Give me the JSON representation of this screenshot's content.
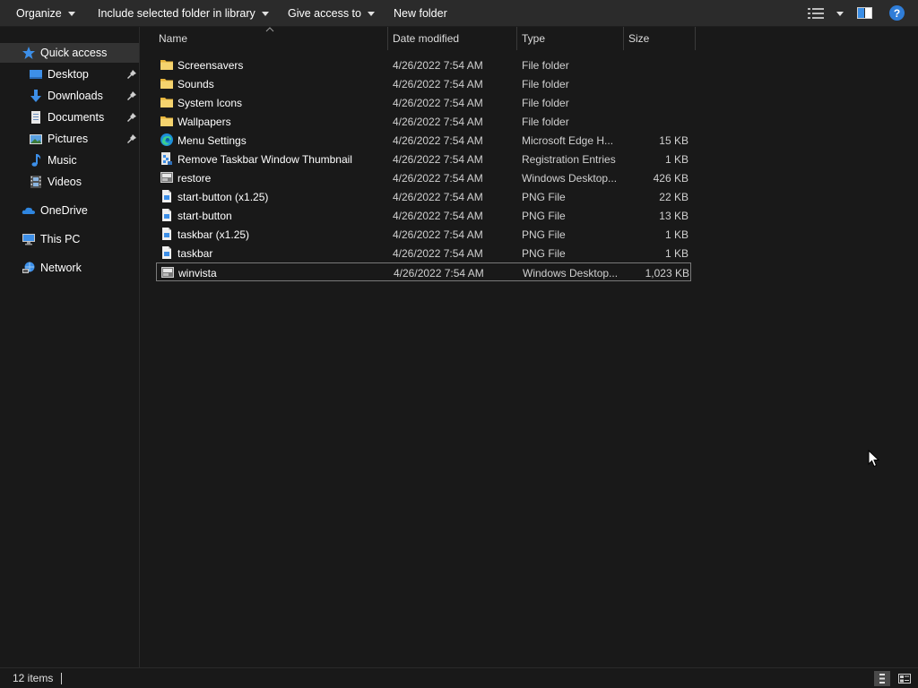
{
  "toolbar": {
    "organize": "Organize",
    "include_library": "Include selected folder in library",
    "give_access": "Give access to",
    "new_folder": "New folder",
    "help": "?"
  },
  "sidebar": {
    "items": [
      {
        "label": "Quick access",
        "icon": "star-icon",
        "pinned": false,
        "active": true
      },
      {
        "label": "Desktop",
        "icon": "desktop-icon",
        "pinned": true
      },
      {
        "label": "Downloads",
        "icon": "download-arrow-icon",
        "pinned": true
      },
      {
        "label": "Documents",
        "icon": "documents-icon",
        "pinned": true
      },
      {
        "label": "Pictures",
        "icon": "pictures-icon",
        "pinned": true
      },
      {
        "label": "Music",
        "icon": "music-note-icon",
        "pinned": false
      },
      {
        "label": "Videos",
        "icon": "film-icon",
        "pinned": false
      },
      {
        "label": "OneDrive",
        "icon": "cloud-icon",
        "pinned": false
      },
      {
        "label": "This PC",
        "icon": "monitor-icon",
        "pinned": false
      },
      {
        "label": "Network",
        "icon": "network-icon",
        "pinned": false
      }
    ]
  },
  "columns": {
    "name": "Name",
    "date": "Date modified",
    "type": "Type",
    "size": "Size"
  },
  "files": [
    {
      "name": "Screensavers",
      "date": "4/26/2022 7:54 AM",
      "type": "File folder",
      "size": "",
      "icon": "folder-icon"
    },
    {
      "name": "Sounds",
      "date": "4/26/2022 7:54 AM",
      "type": "File folder",
      "size": "",
      "icon": "folder-icon"
    },
    {
      "name": "System Icons",
      "date": "4/26/2022 7:54 AM",
      "type": "File folder",
      "size": "",
      "icon": "folder-icon"
    },
    {
      "name": "Wallpapers",
      "date": "4/26/2022 7:54 AM",
      "type": "File folder",
      "size": "",
      "icon": "folder-icon"
    },
    {
      "name": "Menu Settings",
      "date": "4/26/2022 7:54 AM",
      "type": "Microsoft Edge H...",
      "size": "15 KB",
      "icon": "edge-icon"
    },
    {
      "name": "Remove Taskbar Window Thumbnail",
      "date": "4/26/2022 7:54 AM",
      "type": "Registration Entries",
      "size": "1 KB",
      "icon": "registry-icon"
    },
    {
      "name": "restore",
      "date": "4/26/2022 7:54 AM",
      "type": "Windows Desktop...",
      "size": "426 KB",
      "icon": "theme-file-icon"
    },
    {
      "name": "start-button (x1.25)",
      "date": "4/26/2022 7:54 AM",
      "type": "PNG File",
      "size": "22 KB",
      "icon": "png-file-icon"
    },
    {
      "name": "start-button",
      "date": "4/26/2022 7:54 AM",
      "type": "PNG File",
      "size": "13 KB",
      "icon": "png-file-icon"
    },
    {
      "name": "taskbar (x1.25)",
      "date": "4/26/2022 7:54 AM",
      "type": "PNG File",
      "size": "1 KB",
      "icon": "png-file-icon"
    },
    {
      "name": "taskbar",
      "date": "4/26/2022 7:54 AM",
      "type": "PNG File",
      "size": "1 KB",
      "icon": "png-file-icon"
    },
    {
      "name": "winvista",
      "date": "4/26/2022 7:54 AM",
      "type": "Windows Desktop...",
      "size": "1,023 KB",
      "icon": "theme-file-icon",
      "selected": true
    }
  ],
  "status": {
    "item_count": "12 items"
  },
  "colors": {
    "background": "#191919",
    "toolbar": "#2b2b2b",
    "folder": "#f2c94c",
    "accent_blue": "#2f7dd8"
  }
}
